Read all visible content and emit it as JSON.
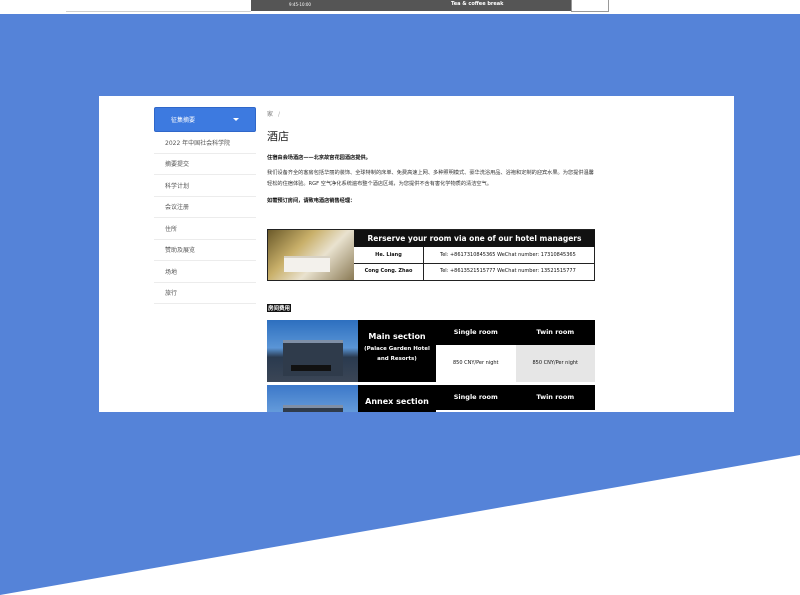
{
  "top_strip": {
    "time": "9:45-10:00",
    "event": "Tea & coffee break"
  },
  "sidebar": {
    "header": "征集摘要",
    "items": [
      {
        "label": "2022 年中国社会科学院"
      },
      {
        "label": "摘要提交"
      },
      {
        "label": "科学计划"
      },
      {
        "label": "会议注册"
      },
      {
        "label": "住所"
      },
      {
        "label": "赞助及展览"
      },
      {
        "label": "场地"
      },
      {
        "label": "旅行"
      }
    ]
  },
  "main": {
    "breadcrumb": {
      "home": "家",
      "separator": "/"
    },
    "title": "酒店",
    "intro_bold": "住宿由会场酒店——北京故宫花园酒店提供。",
    "intro_text": "我们设备齐全的客房包括华丽的装饰、全球特制的床单、免费高速上网、多种照明模式、豪华洗浴用品、浴袍和定制的迎宾水果。为您提供温馨轻松的住宿体验。RGF 空气净化系统遍布整个酒店区域，为您提供不含有害化学物质的清洁空气。",
    "booking_bold": "如需预订房间，请致电酒店销售经理：",
    "reserve": {
      "header": "Rerserve your room via one of our hotel managers",
      "contacts": [
        {
          "name": "He. Liang",
          "info": "Tel:  +8617310845365    WeChat number: 17310845365"
        },
        {
          "name": "Cong Cong. Zhao",
          "info": "Tel:  +8613521515777    WeChat number: 13521515777"
        }
      ]
    },
    "section_label": "房间费用",
    "rooms": [
      {
        "title": "Main section",
        "subtitle": "(Palace Garden Hotel and Resorts)",
        "single_header": "Single room",
        "twin_header": "Twin room",
        "single_price": "850 CNY/Per night",
        "twin_price": "850 CNY/Per night"
      },
      {
        "title": "Annex section",
        "subtitle": "",
        "single_header": "Single room",
        "twin_header": "Twin room",
        "single_price": "",
        "twin_price": ""
      }
    ]
  },
  "colors": {
    "background": "#5583d8",
    "sidebar_active": "#3d7ae0",
    "table_header": "#000000"
  }
}
